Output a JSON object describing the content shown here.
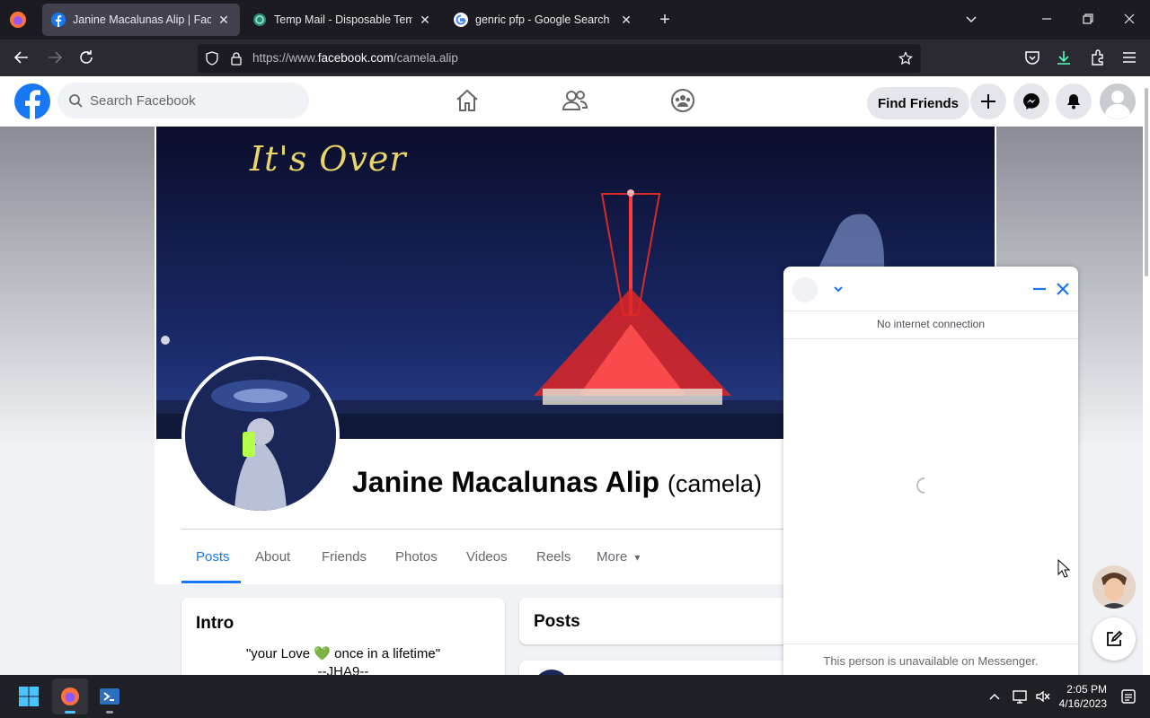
{
  "browser": {
    "tabs": [
      {
        "title": "Janine Macalunas Alip | Facebo",
        "close": "✕"
      },
      {
        "title": "Temp Mail - Disposable Tempor",
        "close": "✕"
      },
      {
        "title": "genric pfp - Google Search",
        "close": "✕"
      }
    ],
    "new_tab": "+",
    "url_prefix": "https://www.",
    "url_domain": "facebook.com",
    "url_path": "/camela.alip"
  },
  "facebook": {
    "search_placeholder": "Search Facebook",
    "find_friends_label": "Find Friends",
    "colors": {
      "brand": "#1877f2"
    }
  },
  "profile": {
    "cover_text": "It's Over",
    "name": "Janine Macalunas Alip",
    "alt_name": "(camela)",
    "tabs": [
      "Posts",
      "About",
      "Friends",
      "Photos",
      "Videos",
      "Reels",
      "More"
    ],
    "more_arrow": "▾",
    "active_tab": "Posts"
  },
  "intro": {
    "title": "Intro",
    "bio_line1_pre": "\"your Love ",
    "bio_heart": "💚",
    "bio_line1_post": " once in a lifetime\"",
    "bio_line2": "--JHA9--"
  },
  "posts": {
    "title": "Posts"
  },
  "messenger": {
    "status": "No internet connection",
    "footer": "This person is unavailable on Messenger."
  },
  "taskbar": {
    "time": "2:05 PM",
    "date": "4/16/2023"
  }
}
